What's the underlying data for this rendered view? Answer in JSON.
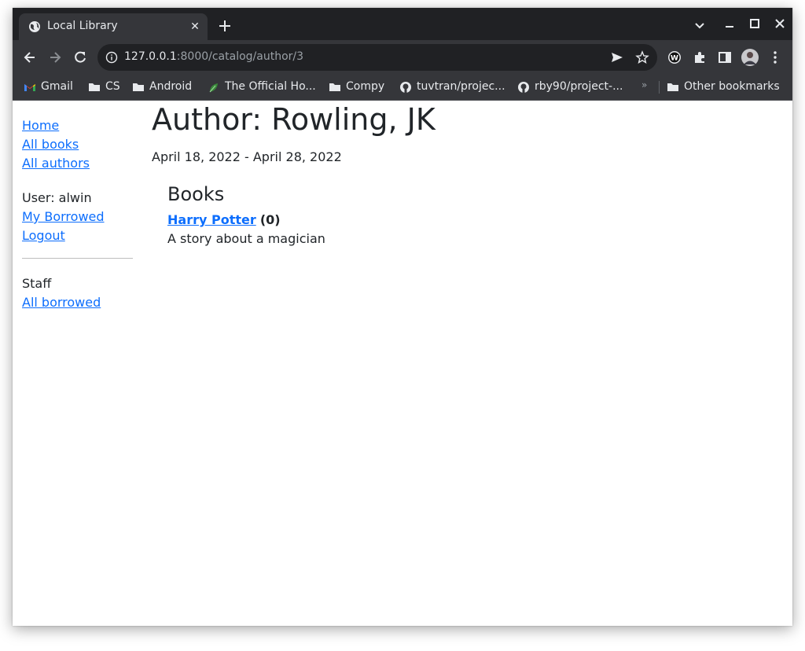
{
  "browser": {
    "tab_title": "Local Library",
    "url_host": "127.0.0.1",
    "url_rest": ":8000/catalog/author/3",
    "bookmarks": [
      {
        "label": "Gmail",
        "icon": "gmail-icon"
      },
      {
        "label": "CS",
        "icon": "folder-icon"
      },
      {
        "label": "Android",
        "icon": "folder-icon"
      },
      {
        "label": "The Official Ho...",
        "icon": "leaf-icon"
      },
      {
        "label": "Compy",
        "icon": "folder-icon"
      },
      {
        "label": "tuvtran/projec...",
        "icon": "github-icon"
      },
      {
        "label": "rby90/project-...",
        "icon": "github-icon"
      }
    ],
    "other_bookmarks": "Other bookmarks",
    "colors": {
      "frame": "#202124",
      "toolbar": "#35363a",
      "link": "#0d6efd"
    }
  },
  "sidebar": {
    "home": "Home",
    "all_books": "All books",
    "all_authors": "All authors",
    "user": "User: alwin",
    "my_borrowed": "My Borrowed",
    "logout": "Logout",
    "staff": "Staff",
    "all_borrowed": "All borrowed"
  },
  "author": {
    "heading": "Author: Rowling, JK",
    "dates": "April 18, 2022 - April 28, 2022"
  },
  "books": {
    "heading": "Books",
    "items": [
      {
        "title": "Harry Potter",
        "count": "(0)",
        "summary": "A story about a magician"
      }
    ]
  }
}
